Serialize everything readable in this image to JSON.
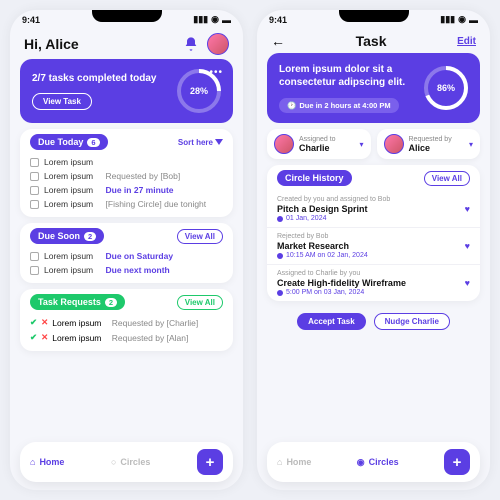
{
  "status_time": "9:41",
  "left": {
    "greeting": "Hi, Alice",
    "hero": {
      "title": "2/7 tasks completed today",
      "cta": "View Task",
      "pct": "28%"
    },
    "due_today": {
      "title": "Due Today",
      "count": "6",
      "sort": "Sort here",
      "items": [
        {
          "t": "Lorem ipsum"
        },
        {
          "t": "Lorem ipsum",
          "sub": "Requested by [Bob]"
        },
        {
          "t": "Lorem ipsum",
          "due": "Due in 27 minute"
        },
        {
          "t": "Lorem ipsum",
          "sub": "[Fishing Circle] due tonight"
        }
      ]
    },
    "due_soon": {
      "title": "Due Soon",
      "count": "2",
      "viewall": "View All",
      "items": [
        {
          "t": "Lorem ipsum",
          "due": "Due on Saturday"
        },
        {
          "t": "Lorem ipsum",
          "due": "Due next month"
        }
      ]
    },
    "requests": {
      "title": "Task Requests",
      "count": "2",
      "viewall": "View All",
      "items": [
        {
          "t": "Lorem ipsum",
          "sub": "Requested by [Charlie]"
        },
        {
          "t": "Lorem ipsum",
          "sub": "Requested by [Alan]"
        }
      ]
    },
    "nav": {
      "home": "Home",
      "circles": "Circles"
    }
  },
  "right": {
    "title": "Task",
    "edit": "Edit",
    "hero": {
      "title": "Lorem ipsum dolor sit a consectetur adipscing elit.",
      "due": "Due in 2 hours at 4:00 PM",
      "pct": "86%"
    },
    "assigned": {
      "label": "Assigned to",
      "name": "Charlie"
    },
    "requested": {
      "label": "Requested by",
      "name": "Alice"
    },
    "history": {
      "title": "Circle History",
      "viewall": "View All",
      "items": [
        {
          "meta": "Created by you and assigned to Bob",
          "title": "Pitch a Design Sprint",
          "time": "01 Jan, 2024"
        },
        {
          "meta": "Rejected by Bob",
          "title": "Market Research",
          "time": "10:15 AM on 02 Jan, 2024"
        },
        {
          "meta": "Assigned to Charlie by you",
          "title": "Create High-fidelity Wireframe",
          "time": "5:00 PM on 03 Jan, 2024"
        }
      ]
    },
    "actions": {
      "accept": "Accept Task",
      "nudge": "Nudge Charlie"
    },
    "nav": {
      "home": "Home",
      "circles": "Circles"
    }
  }
}
